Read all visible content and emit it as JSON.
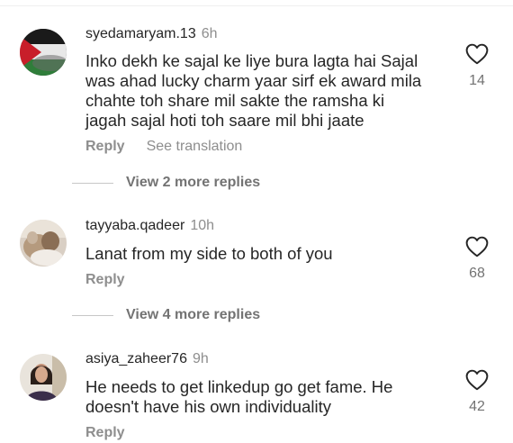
{
  "comments": [
    {
      "username": "syedamaryam.13",
      "time": "6h",
      "text_lines": [
        "Inko dekh ke sajal ke liye bura lagta hai Sajal",
        "was ahad lucky charm yaar sirf ek award mila",
        "chahte toh share mil sakte the ramsha ki",
        "jagah sajal hoti toh saare mil bhi  jaate"
      ],
      "reply_label": "Reply",
      "translation_label": "See translation",
      "likes": "14",
      "view_more": "View 2 more replies"
    },
    {
      "username": "tayyaba.qadeer",
      "time": "10h",
      "text_lines": [
        "Lanat from my side to both of you"
      ],
      "reply_label": "Reply",
      "likes": "68",
      "view_more": "View 4 more replies"
    },
    {
      "username": "asiya_zaheer76",
      "time": "9h",
      "text_lines": [
        "He needs to get linkedup go get fame. He",
        "doesn't have his own individuality"
      ],
      "reply_label": "Reply",
      "likes": "42"
    }
  ],
  "icons": {
    "like": "heart-outline-icon"
  },
  "colors": {
    "text": "#262626",
    "secondary": "#8e8e8e",
    "background": "#ffffff"
  }
}
